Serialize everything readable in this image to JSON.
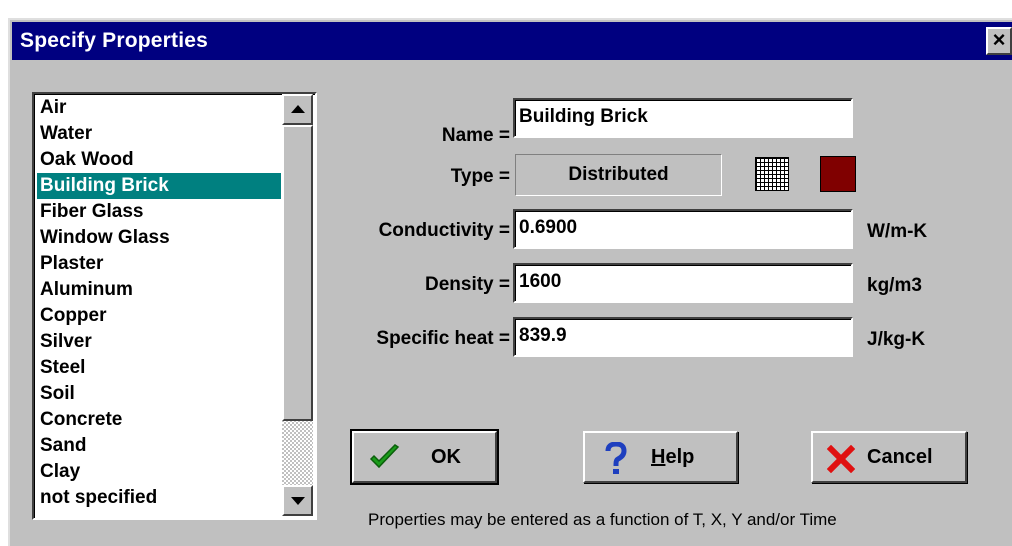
{
  "window": {
    "title": "Specify Properties",
    "close_label": "×"
  },
  "materials": {
    "items": [
      "Air",
      "Water",
      "Oak Wood",
      "Building Brick",
      "Fiber Glass",
      "Window Glass",
      "Plaster",
      "Aluminum",
      "Copper",
      "Silver",
      "Steel",
      "Soil",
      "Concrete",
      "Sand",
      "Clay",
      "not specified"
    ],
    "selected": "Building Brick"
  },
  "form": {
    "name_label": "Name =",
    "name_value": "Building Brick",
    "type_label": "Type =",
    "type_value": "Distributed",
    "type_pattern_icon": "grid-pattern-icon",
    "type_color": "#800000",
    "conductivity_label": "Conductivity =",
    "conductivity_value": "0.6900",
    "conductivity_unit": "W/m-K",
    "density_label": "Density =",
    "density_value": "1600",
    "density_unit": "kg/m3",
    "specific_heat_label": "Specific heat =",
    "specific_heat_value": "839.9",
    "specific_heat_unit": "J/kg-K"
  },
  "buttons": {
    "ok_label": "OK",
    "help_label": "Help",
    "cancel_label": "Cancel"
  },
  "note": "Properties may be entered as a function of T, X, Y and/or Time",
  "colors": {
    "titlebar": "#000080",
    "selection": "#008080",
    "face": "#c0c0c0"
  }
}
